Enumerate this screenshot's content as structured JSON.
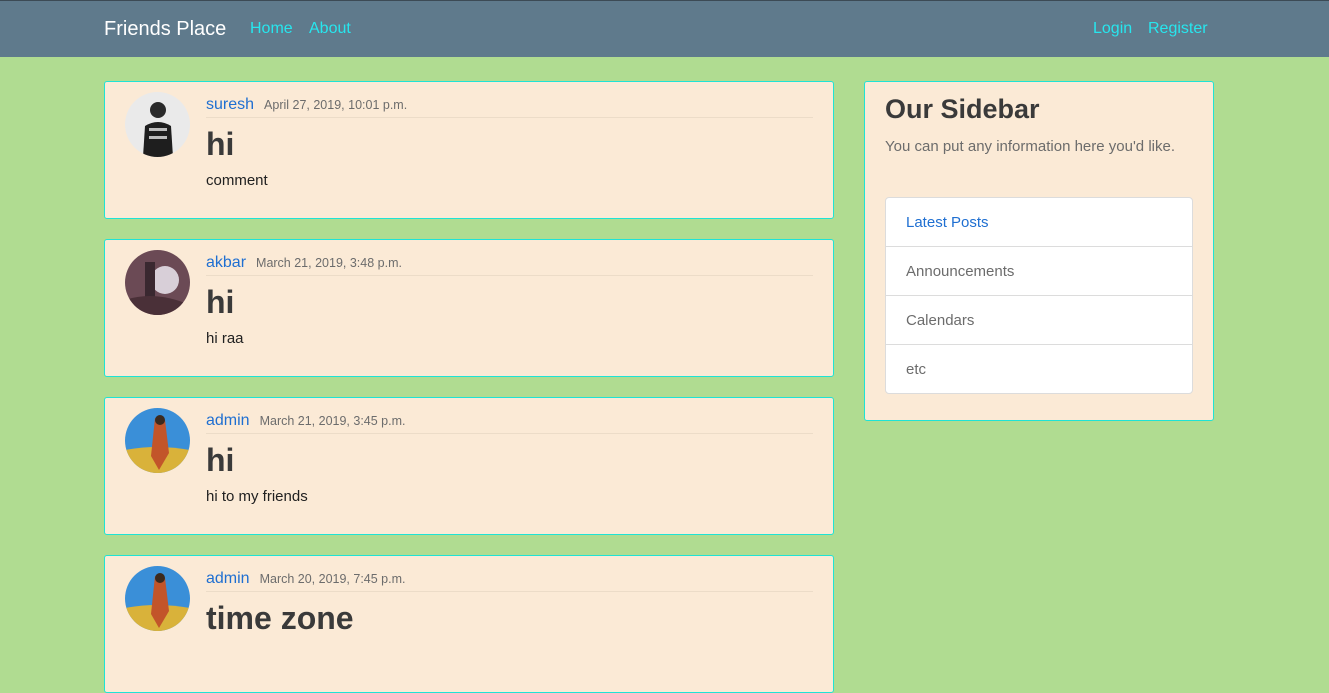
{
  "navbar": {
    "brand": "Friends Place",
    "links": [
      "Home",
      "About"
    ],
    "auth_links": [
      "Login",
      "Register"
    ]
  },
  "posts": [
    {
      "author": "suresh",
      "date": "April 27, 2019, 10:01 p.m.",
      "title": "hi",
      "content": "comment"
    },
    {
      "author": "akbar",
      "date": "March 21, 2019, 3:48 p.m.",
      "title": "hi",
      "content": "hi raa"
    },
    {
      "author": "admin",
      "date": "March 21, 2019, 3:45 p.m.",
      "title": "hi",
      "content": "hi to my friends"
    },
    {
      "author": "admin",
      "date": "March 20, 2019, 7:45 p.m.",
      "title": "time zone",
      "content": ""
    }
  ],
  "sidebar": {
    "title": "Our Sidebar",
    "text": "You can put any information here you'd like.",
    "items": [
      "Latest Posts",
      "Announcements",
      "Calendars",
      "etc"
    ]
  },
  "colors": {
    "background": "#b0dc91",
    "navbar": "#5f7a8c",
    "nav_link": "#27e6ee",
    "card": "#fbead6",
    "card_border": "#1fe3d6",
    "author_link": "#1f6fd1"
  }
}
